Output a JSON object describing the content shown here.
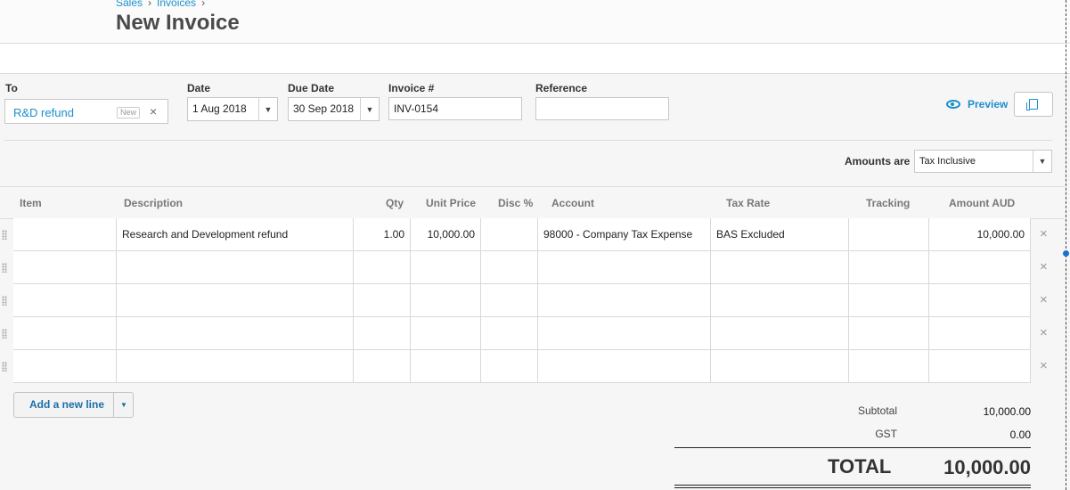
{
  "header": {
    "breadcrumbs": [
      "Sales",
      "Invoices"
    ],
    "breadcrumb_sep": "›",
    "title": "New Invoice"
  },
  "form": {
    "to": {
      "label": "To",
      "value": "R&D refund",
      "badge": "New"
    },
    "date": {
      "label": "Date",
      "value": "1 Aug 2018"
    },
    "due_date": {
      "label": "Due Date",
      "value": "30 Sep 2018"
    },
    "invoice_no": {
      "label": "Invoice #",
      "value": "INV-0154"
    },
    "reference": {
      "label": "Reference",
      "value": ""
    },
    "preview_label": "Preview"
  },
  "amounts": {
    "label": "Amounts are",
    "value": "Tax Inclusive"
  },
  "table": {
    "columns": [
      "Item",
      "Description",
      "Qty",
      "Unit Price",
      "Disc %",
      "Account",
      "Tax Rate",
      "Tracking",
      "Amount AUD"
    ],
    "rows": [
      {
        "item": "",
        "description": "Research and Development refund",
        "qty": "1.00",
        "unit_price": "10,000.00",
        "disc": "",
        "account": "98000 - Company Tax Expense",
        "tax_rate": "BAS Excluded",
        "tracking": "",
        "amount": "10,000.00"
      },
      {
        "item": "",
        "description": "",
        "qty": "",
        "unit_price": "",
        "disc": "",
        "account": "",
        "tax_rate": "",
        "tracking": "",
        "amount": ""
      },
      {
        "item": "",
        "description": "",
        "qty": "",
        "unit_price": "",
        "disc": "",
        "account": "",
        "tax_rate": "",
        "tracking": "",
        "amount": ""
      },
      {
        "item": "",
        "description": "",
        "qty": "",
        "unit_price": "",
        "disc": "",
        "account": "",
        "tax_rate": "",
        "tracking": "",
        "amount": ""
      },
      {
        "item": "",
        "description": "",
        "qty": "",
        "unit_price": "",
        "disc": "",
        "account": "",
        "tax_rate": "",
        "tracking": "",
        "amount": ""
      }
    ],
    "remove_glyph": "×"
  },
  "add_line": {
    "label": "Add a new line"
  },
  "totals": {
    "subtotal_label": "Subtotal",
    "subtotal": "10,000.00",
    "gst_label": "GST",
    "gst": "0.00",
    "total_label": "TOTAL",
    "total": "10,000.00"
  },
  "icons": {
    "close": "close-icon",
    "dropdown": "chevron-down-icon",
    "preview": "eye-icon",
    "copy": "copy-icon",
    "drag": "drag-handle-icon"
  },
  "colors": {
    "link": "#1a8fcb",
    "background": "#f6f6f6",
    "cell_bg": "#ffffff"
  }
}
